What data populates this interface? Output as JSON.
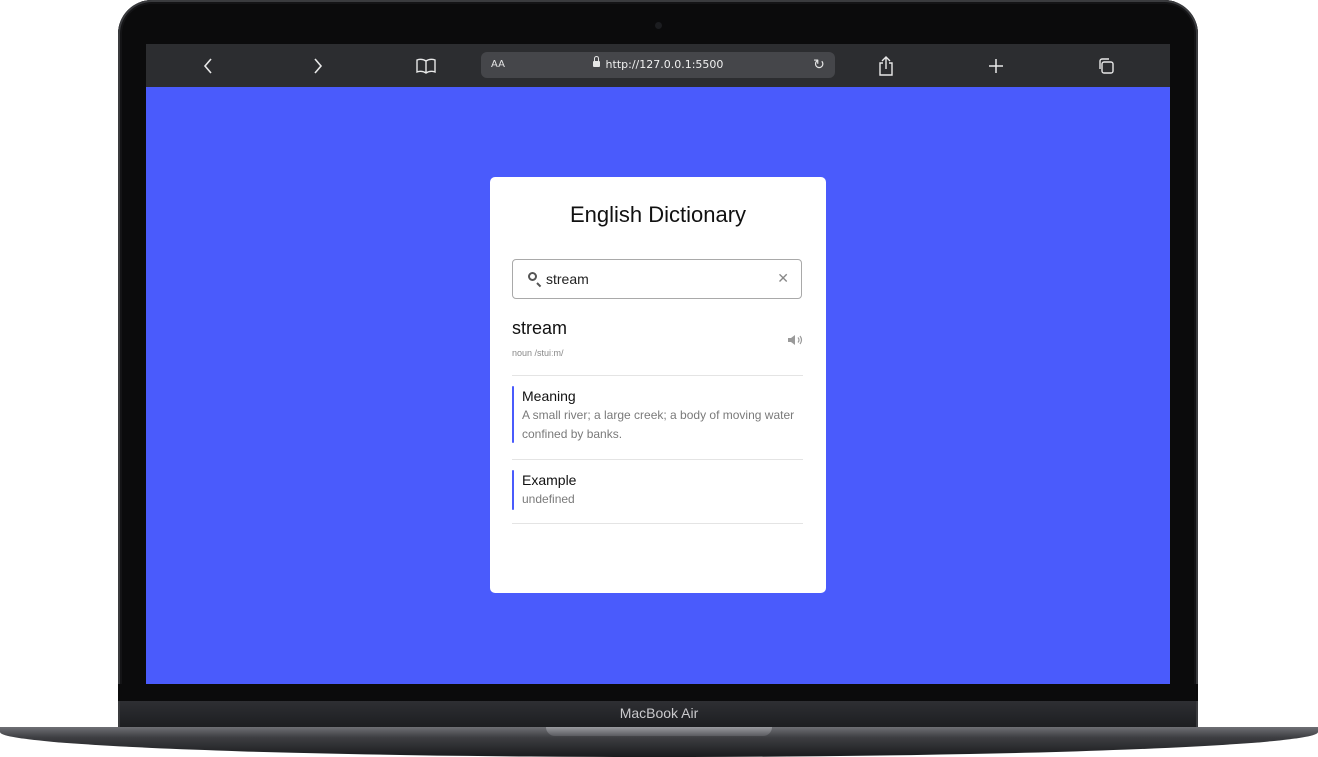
{
  "device": {
    "model_label": "MacBook Air"
  },
  "browser": {
    "text_size_label": "AA",
    "url": "http://127.0.0.1:5500",
    "icons": [
      "back-icon",
      "forward-icon",
      "bookmarks-icon",
      "lock-icon",
      "reload-icon",
      "share-icon",
      "new-tab-icon",
      "tabs-icon"
    ]
  },
  "app": {
    "title": "English Dictionary",
    "search": {
      "value": "stream",
      "placeholder": ""
    },
    "result": {
      "word": "stream",
      "phonetic": "noun /stuiːm/",
      "meaning_title": "Meaning",
      "meaning_text": "A small river; a large creek; a body of moving water confined by banks.",
      "example_title": "Example",
      "example_text": "undefined"
    }
  },
  "colors": {
    "background": "#4a5bfc",
    "accent": "#4a5bfc",
    "card": "#ffffff"
  }
}
